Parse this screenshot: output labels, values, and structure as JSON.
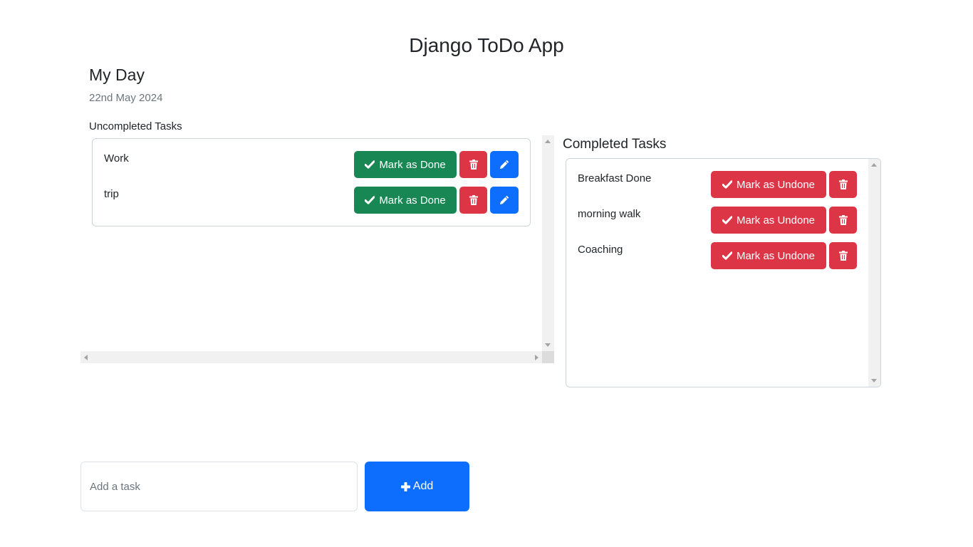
{
  "header": {
    "app_title": "Django ToDo App"
  },
  "day": {
    "title": "My Day",
    "date": "22nd May 2024"
  },
  "uncompleted": {
    "label": "Uncompleted Tasks",
    "tasks": [
      {
        "name": "Work",
        "done_label": "Mark as Done"
      },
      {
        "name": "trip",
        "done_label": "Mark as Done"
      }
    ]
  },
  "completed": {
    "label": "Completed Tasks",
    "tasks": [
      {
        "name": "Breakfast Done",
        "undone_label": "Mark as Undone"
      },
      {
        "name": "morning walk",
        "undone_label": "Mark as Undone"
      },
      {
        "name": "Coaching",
        "undone_label": "Mark as Undone"
      }
    ]
  },
  "add_form": {
    "placeholder": "Add a task",
    "value": "",
    "button_label": "Add"
  },
  "icons": {
    "check": "check-icon",
    "trash": "trash-icon",
    "edit": "pencil-icon",
    "plus": "plus-icon"
  },
  "colors": {
    "success": "#198754",
    "danger": "#dc3545",
    "primary": "#0d6efd"
  }
}
